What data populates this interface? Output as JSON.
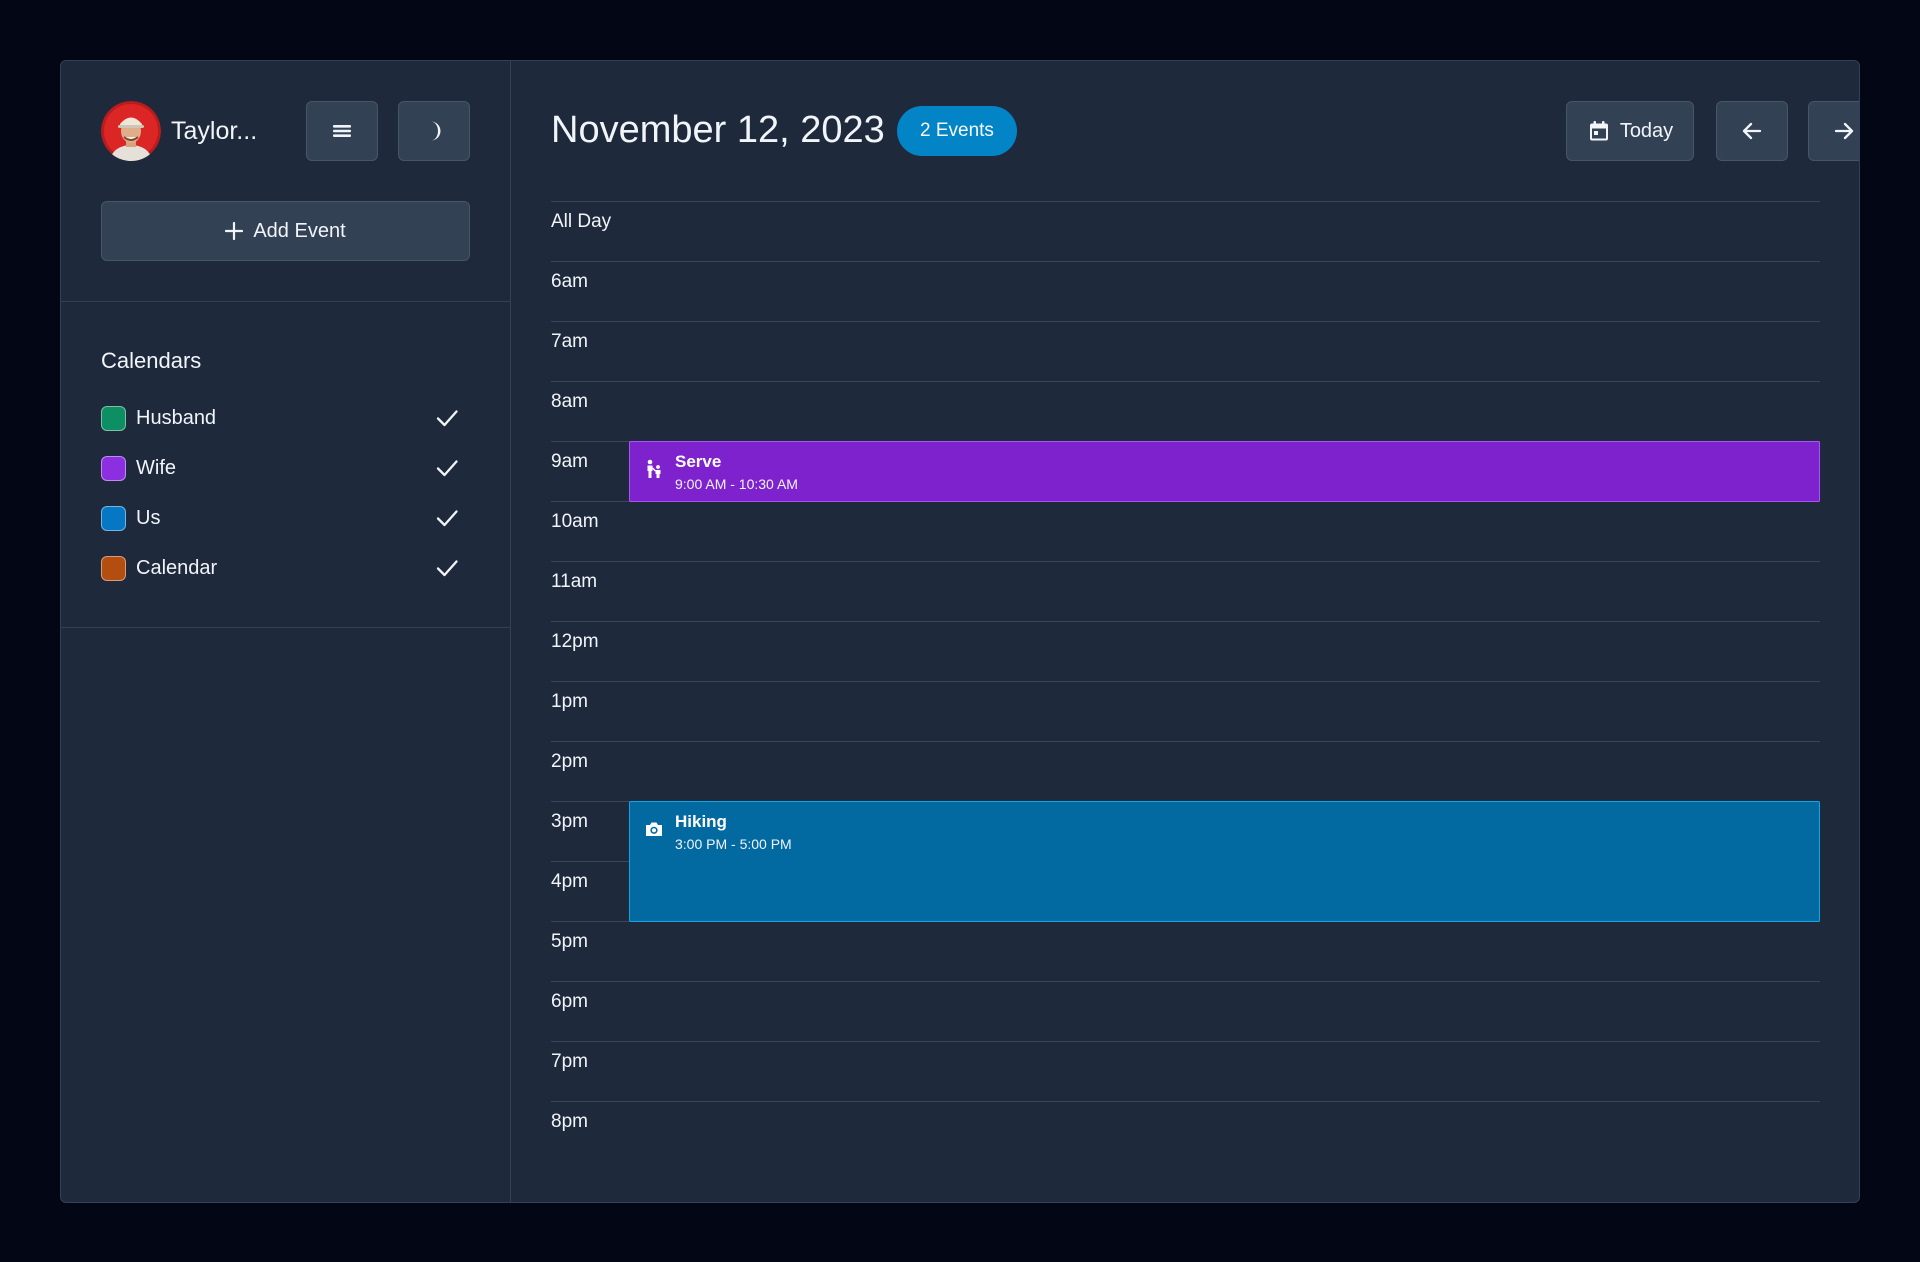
{
  "sidebar": {
    "user": {
      "name": "Taylor..."
    },
    "add_event_label": "Add Event",
    "calendars_title": "Calendars",
    "calendars": [
      {
        "label": "Husband",
        "color": "#0d8f63",
        "checked": true
      },
      {
        "label": "Wife",
        "color": "#8b2fe0",
        "checked": true
      },
      {
        "label": "Us",
        "color": "#0577c4",
        "checked": true
      },
      {
        "label": "Calendar",
        "color": "#b34d10",
        "checked": true
      }
    ]
  },
  "header": {
    "date": "November 12, 2023",
    "events_badge": "2 Events",
    "today_label": "Today"
  },
  "grid": {
    "all_day_label": "All Day",
    "hours": [
      "6am",
      "7am",
      "8am",
      "9am",
      "10am",
      "11am",
      "12pm",
      "1pm",
      "2pm",
      "3pm",
      "4pm",
      "5pm",
      "6pm",
      "7pm",
      "8pm"
    ]
  },
  "events": [
    {
      "title": "Serve",
      "time": "9:00 AM - 10:30 AM",
      "icon": "person-child-icon",
      "color": "#7e22ce"
    },
    {
      "title": "Hiking",
      "time": "3:00 PM - 5:00 PM",
      "icon": "camera-icon",
      "color": "#0369a1"
    }
  ]
}
